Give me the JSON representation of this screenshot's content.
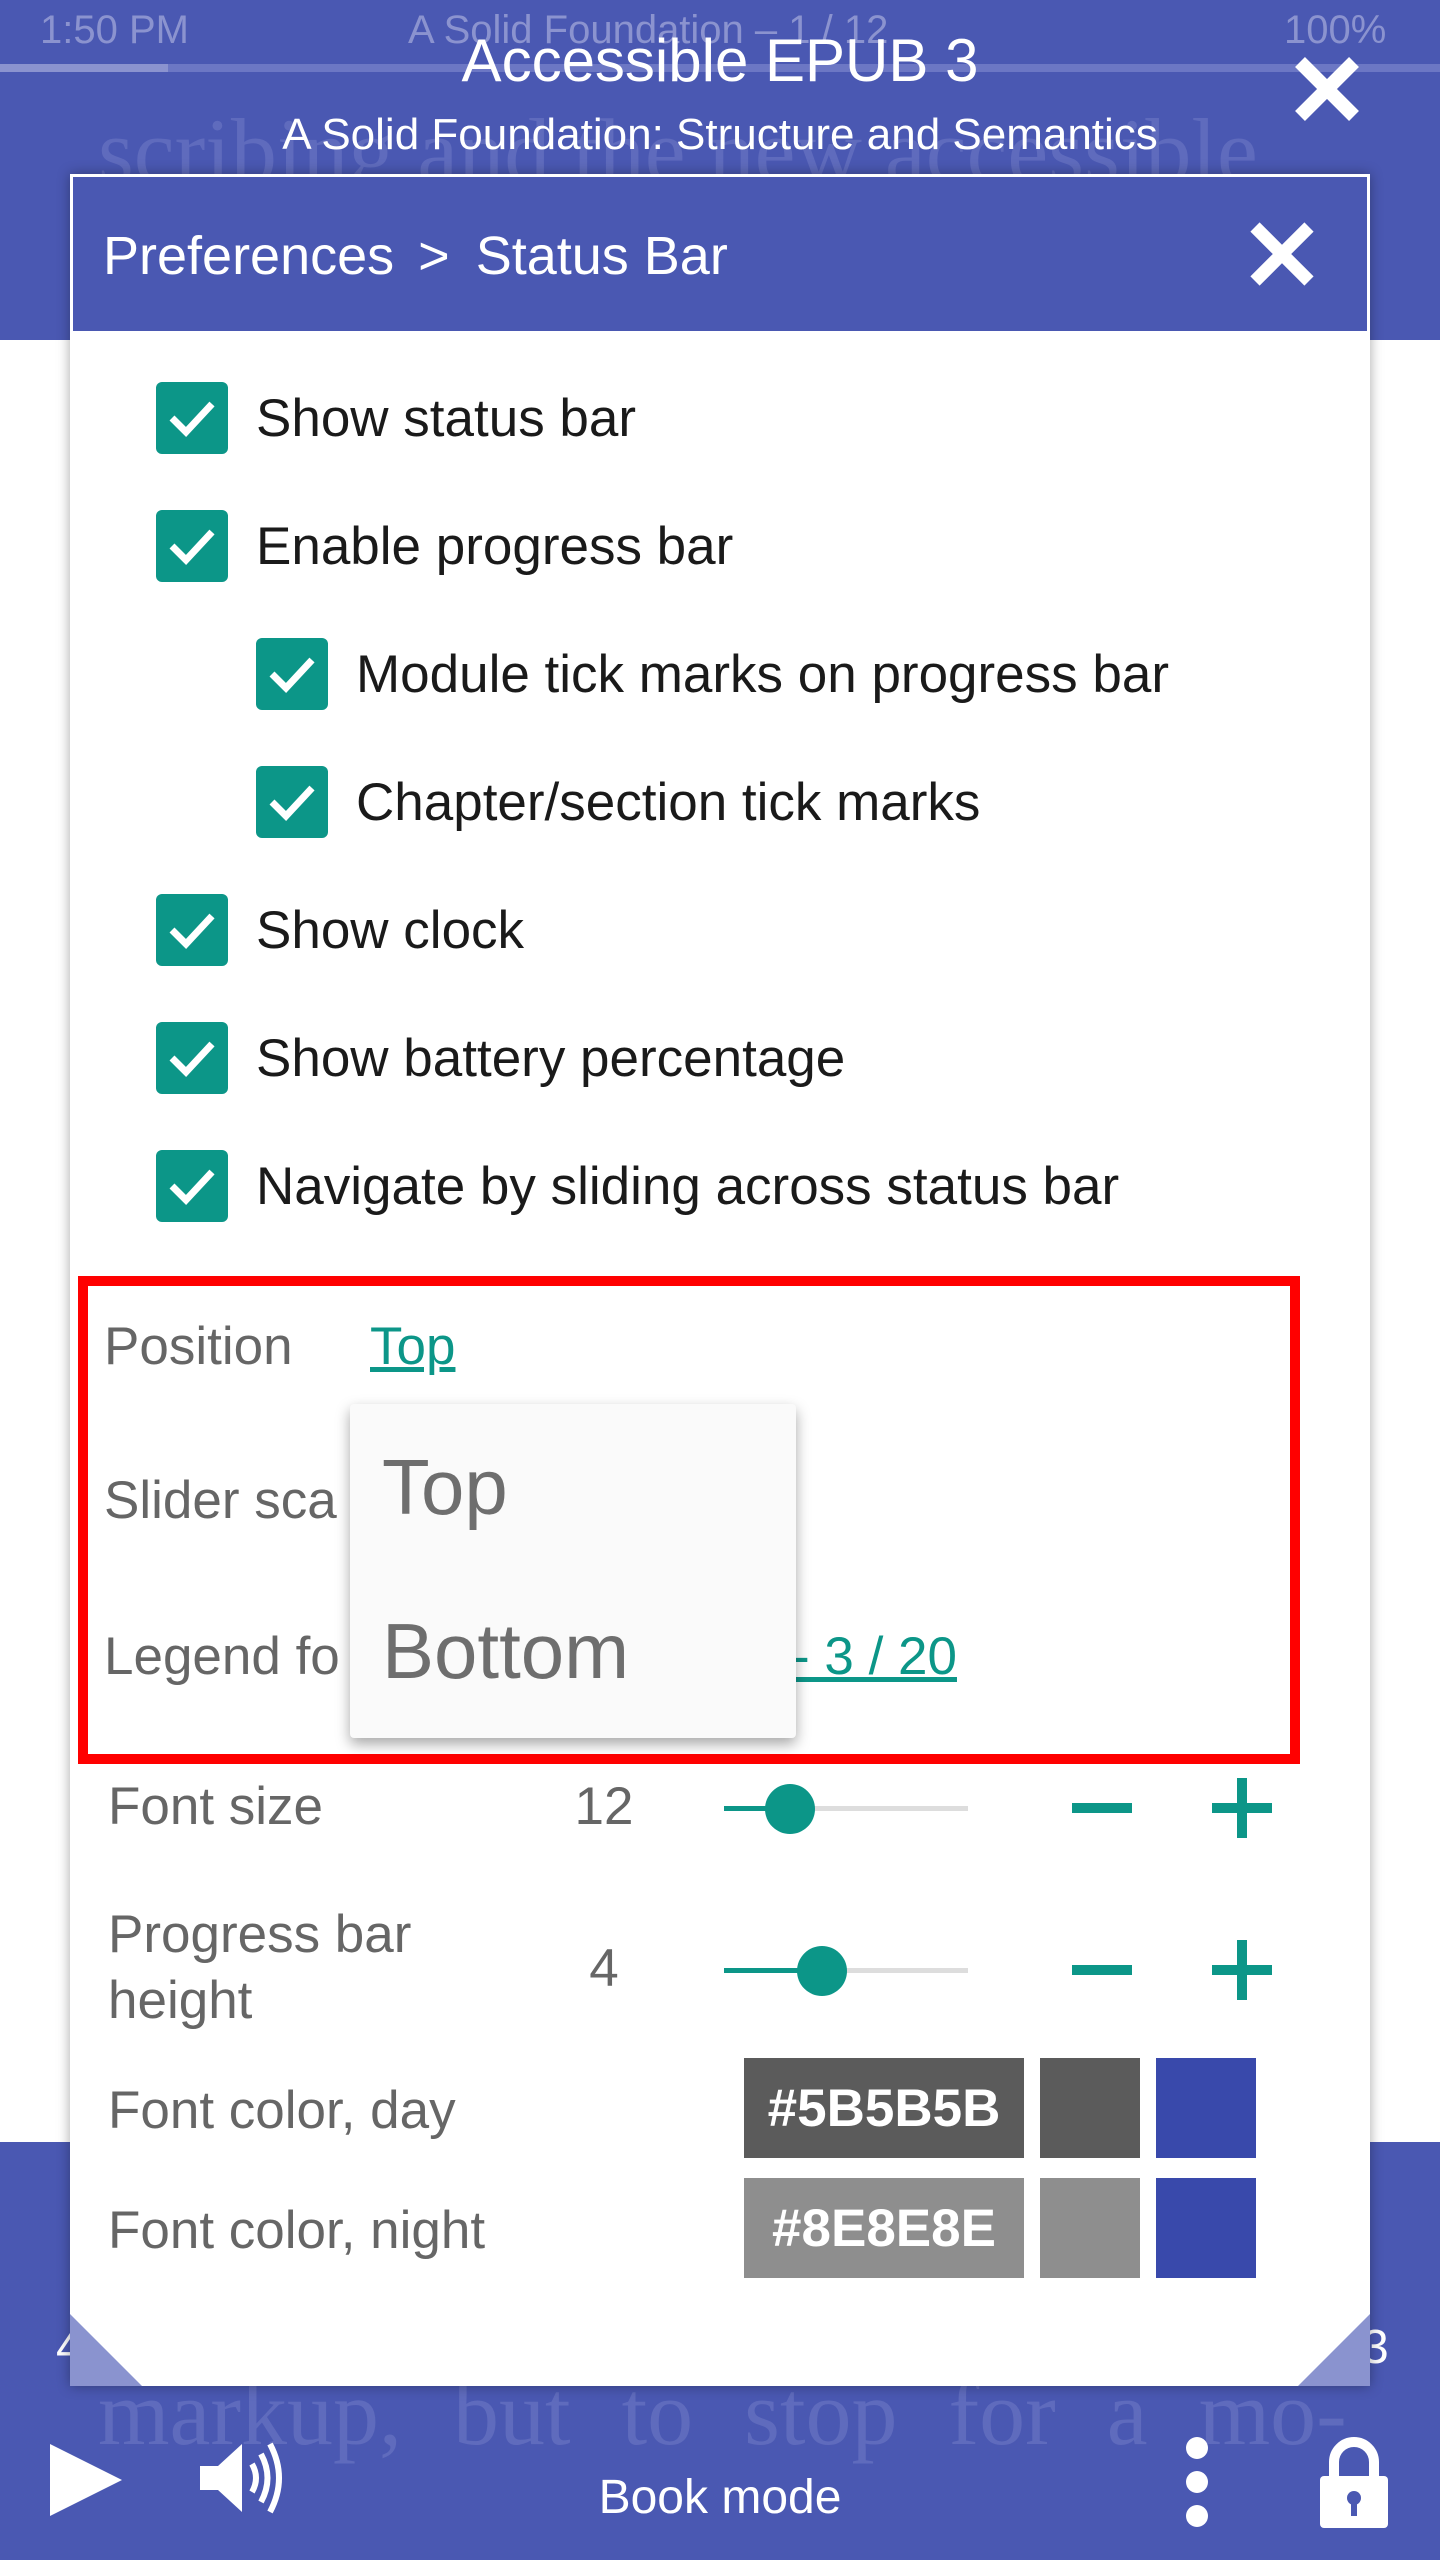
{
  "background": {
    "status_time": "1:50 PM",
    "status_title": "A Solid Foundation – 1 / 12",
    "status_battery": "100%",
    "text_top": "scribing and the new accessible",
    "text_bottom": "markup, but to stop for a mo-",
    "page_left": "4",
    "page_right": "3"
  },
  "header": {
    "title": "Accessible EPUB 3",
    "subtitle": "A Solid Foundation: Structure and Semantics"
  },
  "dialog": {
    "breadcrumb_root": "Preferences",
    "breadcrumb_separator": ">",
    "breadcrumb_current": "Status Bar",
    "checkboxes": [
      {
        "label": "Show status bar",
        "checked": true
      },
      {
        "label": "Enable progress bar",
        "checked": true
      },
      {
        "label": "Module tick marks on progress bar",
        "checked": true
      },
      {
        "label": "Chapter/section tick marks",
        "checked": true
      },
      {
        "label": "Show clock",
        "checked": true
      },
      {
        "label": "Show battery percentage",
        "checked": true
      },
      {
        "label": "Navigate by sliding across status bar",
        "checked": true
      }
    ],
    "position_label": "Position",
    "position_value": "Top",
    "slider_scale_label": "Slider sca",
    "legend_format_label": "Legend fo",
    "legend_format_value": "- 3 / 20",
    "dropdown_options": [
      "Top",
      "Bottom"
    ],
    "font_size": {
      "label": "Font size",
      "value": "12",
      "level": 0.27
    },
    "progress_height": {
      "label_line1": "Progress bar",
      "label_line2": "height",
      "value": "4",
      "level": 0.4
    },
    "font_color_day": {
      "label": "Font color, day",
      "hex": "#5B5B5B",
      "swatch": "#5b5b5b",
      "accent": "#3949ab"
    },
    "font_color_night": {
      "label": "Font color, night",
      "hex": "#8E8E8E",
      "swatch": "#8e8e8e",
      "accent": "#3949ab"
    }
  },
  "footer": {
    "mode_label": "Book mode"
  },
  "colors": {
    "primary": "#4a58b2",
    "accent": "#0c9688",
    "highlight": "#ff0000"
  }
}
